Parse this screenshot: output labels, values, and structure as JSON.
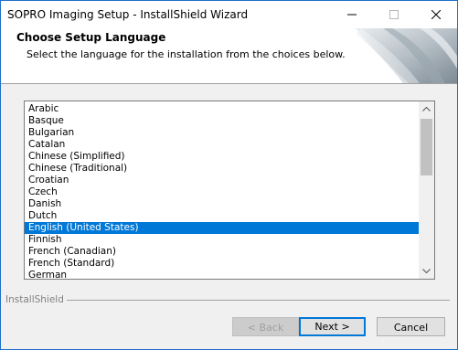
{
  "window": {
    "title": "SOPRO Imaging Setup - InstallShield Wizard"
  },
  "header": {
    "title": "Choose Setup Language",
    "subtitle": "Select the language for the installation from the choices below."
  },
  "language_list": {
    "items": [
      "Arabic",
      "Basque",
      "Bulgarian",
      "Catalan",
      "Chinese (Simplified)",
      "Chinese (Traditional)",
      "Croatian",
      "Czech",
      "Danish",
      "Dutch",
      "English (United States)",
      "Finnish",
      "French (Canadian)",
      "French (Standard)",
      "German"
    ],
    "selected": "English (United States)"
  },
  "footer": {
    "brand": "InstallShield"
  },
  "buttons": {
    "back": "< Back",
    "next": "Next >",
    "cancel": "Cancel"
  },
  "colors": {
    "accent": "#0078d7",
    "selection_text": "#ffffff",
    "border": "#1e6fc9"
  },
  "icons": {
    "minimize": "minimize-icon",
    "maximize": "maximize-icon",
    "close": "close-icon",
    "scroll_up": "chevron-up-icon",
    "scroll_down": "chevron-down-icon"
  }
}
